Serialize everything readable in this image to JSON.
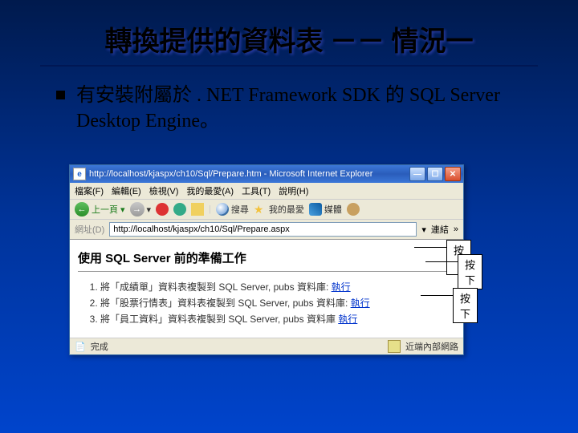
{
  "slide": {
    "title": "轉換提供的資料表 －－ 情況一",
    "bullet": "有安裝附屬於 . NET Framework SDK 的 SQL Server Desktop Engine。"
  },
  "window": {
    "title": "http://localhost/kjaspx/ch10/Sql/Prepare.htm - Microsoft Internet Explorer",
    "menu": {
      "file": "檔案(F)",
      "edit": "編輯(E)",
      "view": "檢視(V)",
      "fav": "我的最愛(A)",
      "tools": "工具(T)",
      "help": "說明(H)"
    },
    "toolbar": {
      "back": "上一頁",
      "search": "搜尋",
      "fav": "我的最愛",
      "media": "媒體"
    },
    "address": {
      "label": "網址(D)",
      "value": "http://localhost/kjaspx/ch10/Sql/Prepare.aspx",
      "go": "連結"
    },
    "page": {
      "heading": "使用 SQL Server 前的準備工作",
      "items": [
        {
          "text": "將「成績單」資料表複製到 SQL Server, pubs 資料庫: ",
          "link": "執行"
        },
        {
          "text": "將「股票行情表」資料表複製到 SQL Server, pubs 資料庫: ",
          "link": "執行"
        },
        {
          "text": "將「員工資料」資料表複製到 SQL Server, pubs 資料庫 ",
          "link": "執行"
        }
      ]
    },
    "status": {
      "done": "完成",
      "zone": "近端內部網路"
    }
  },
  "callouts": {
    "press": "按下"
  }
}
